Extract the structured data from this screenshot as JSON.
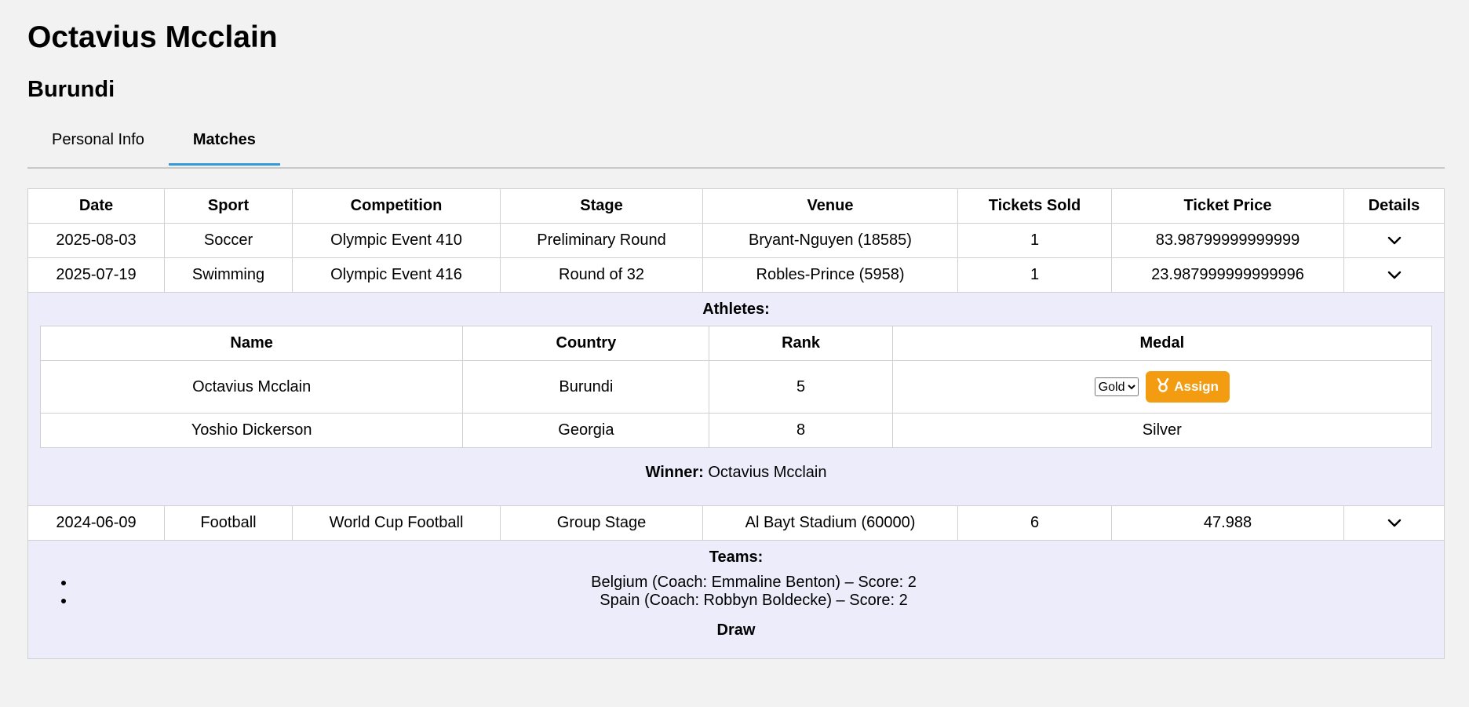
{
  "athlete": {
    "name": "Octavius Mcclain",
    "country": "Burundi"
  },
  "tabs": [
    {
      "label": "Personal Info"
    },
    {
      "label": "Matches"
    }
  ],
  "table": {
    "headers": [
      "Date",
      "Sport",
      "Competition",
      "Stage",
      "Venue",
      "Tickets Sold",
      "Ticket Price",
      "Details"
    ],
    "rows": [
      {
        "date": "2025-08-03",
        "sport": "Soccer",
        "competition": "Olympic Event 410",
        "stage": "Preliminary Round",
        "venue": "Bryant-Nguyen (18585)",
        "tickets_sold": "1",
        "ticket_price": "83.98799999999999",
        "details_icon": "chevron-down-icon"
      },
      {
        "date": "2025-07-19",
        "sport": "Swimming",
        "competition": "Olympic Event 416",
        "stage": "Round of 32",
        "venue": "Robles-Prince (5958)",
        "tickets_sold": "1",
        "ticket_price": "23.987999999999996",
        "details_icon": "chevron-down-icon"
      },
      {
        "date": "2024-06-09",
        "sport": "Football",
        "competition": "World Cup Football",
        "stage": "Group Stage",
        "venue": "Al Bayt Stadium (60000)",
        "tickets_sold": "6",
        "ticket_price": "47.988",
        "details_icon": "chevron-down-icon"
      }
    ]
  },
  "swimming_details": {
    "title": "Athletes:",
    "headers": [
      "Name",
      "Country",
      "Rank",
      "Medal"
    ],
    "athletes": [
      {
        "name": "Octavius Mcclain",
        "country": "Burundi",
        "rank": "5",
        "medal_select": "Gold",
        "assign_label": "Assign",
        "assign_icon": "medal-icon"
      },
      {
        "name": "Yoshio Dickerson",
        "country": "Georgia",
        "rank": "8",
        "medal": "Silver"
      }
    ],
    "winner_label": "Winner:",
    "winner_name": "Octavius Mcclain"
  },
  "football_details": {
    "title": "Teams:",
    "teams": [
      "Belgium (Coach: Emmaline Benton) – Score: 2",
      "Spain (Coach: Robbyn Boldecke) – Score: 2"
    ],
    "result": "Draw"
  },
  "colors": {
    "accent": "#3498db",
    "assign": "#f39c12",
    "details_bg": "#ececfb",
    "page_bg": "#f2f2f2"
  }
}
